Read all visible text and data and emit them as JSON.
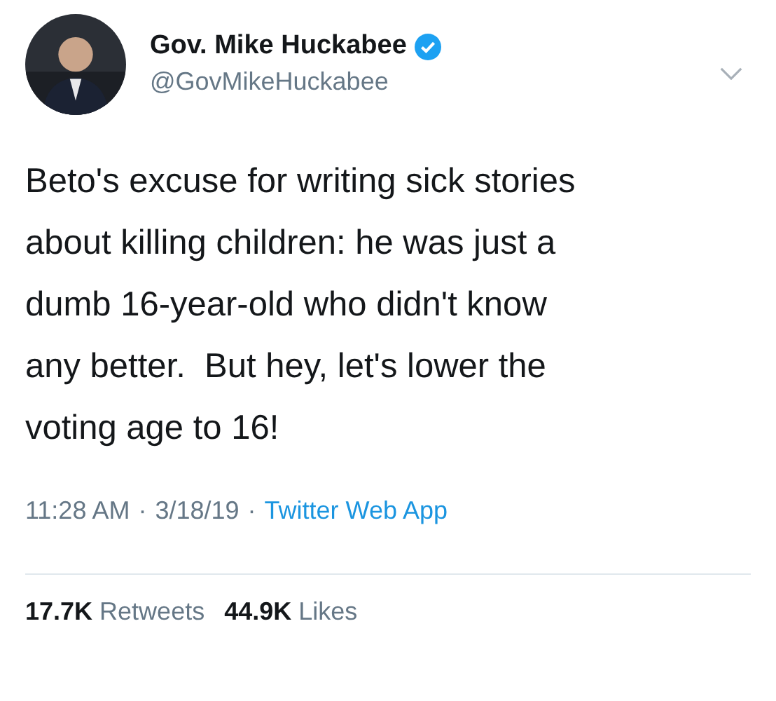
{
  "author": {
    "name": "Gov. Mike Huckabee",
    "verified": true,
    "handle": "@GovMikeHuckabee"
  },
  "text_lines": [
    "Beto's excuse for writing sick stories",
    "about killing children: he was just a",
    "dumb 16-year-old who didn't know",
    "any better.  But hey, let's lower the",
    "voting age to 16!"
  ],
  "meta": {
    "time": "11:28 AM",
    "separator": "·",
    "date": "3/18/19",
    "separator_2": "·",
    "source": "Twitter Web App"
  },
  "stats": [
    {
      "count": "17.7K",
      "label": "Retweets"
    },
    {
      "count": "44.9K",
      "label": "Likes"
    }
  ]
}
